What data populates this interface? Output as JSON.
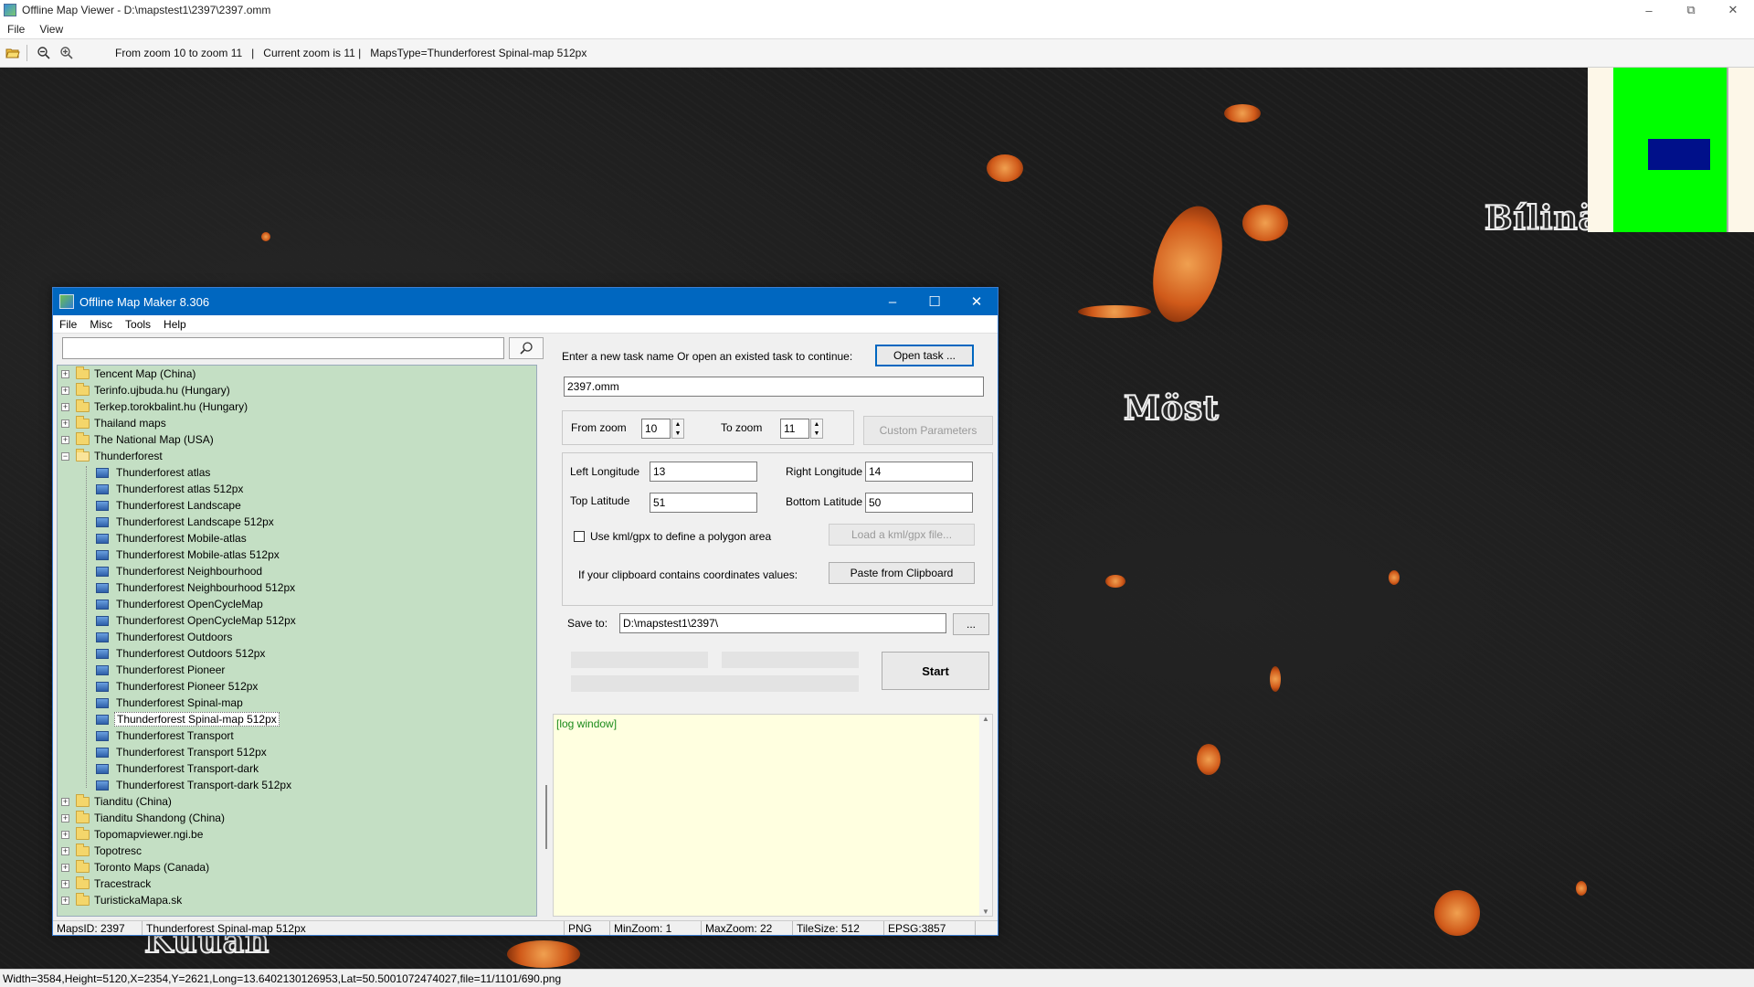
{
  "viewer": {
    "title": "Offline Map Viewer - D:\\mapstest1\\2397\\2397.omm",
    "menu": [
      "File",
      "View"
    ],
    "toolbar_text": "From zoom 10 to zoom 11   |   Current zoom is 11 |   MapsType=Thunderforest Spinal-map 512px",
    "icons": [
      "open-folder-icon",
      "zoom-out-icon",
      "zoom-in-icon"
    ],
    "status": "Width=3584,Height=5120,X=2354,Y=2621,Long=13.6402130126953,Lat=50.5001072474027,file=11/1101/690.png"
  },
  "map": {
    "places": [
      "Bílinä",
      "Möst",
      "Kuuan"
    ]
  },
  "dialog": {
    "title": "Offline Map Maker 8.306",
    "menu": [
      "File",
      "Misc",
      "Tools",
      "Help"
    ],
    "search": {
      "value": "",
      "placeholder": ""
    },
    "tree": [
      {
        "label": "Tencent Map (China)",
        "type": "folder",
        "expanded": false
      },
      {
        "label": "Terinfo.ujbuda.hu (Hungary)",
        "type": "folder",
        "expanded": false
      },
      {
        "label": "Terkep.torokbalint.hu (Hungary)",
        "type": "folder",
        "expanded": false
      },
      {
        "label": "Thailand maps",
        "type": "folder",
        "expanded": false
      },
      {
        "label": "The National Map (USA)",
        "type": "folder",
        "expanded": false
      },
      {
        "label": "Thunderforest",
        "type": "folder",
        "expanded": true
      },
      {
        "label": "Thunderforest atlas",
        "type": "map"
      },
      {
        "label": "Thunderforest atlas 512px",
        "type": "map"
      },
      {
        "label": "Thunderforest Landscape",
        "type": "map"
      },
      {
        "label": "Thunderforest Landscape 512px",
        "type": "map"
      },
      {
        "label": "Thunderforest Mobile-atlas",
        "type": "map"
      },
      {
        "label": "Thunderforest Mobile-atlas 512px",
        "type": "map"
      },
      {
        "label": "Thunderforest Neighbourhood",
        "type": "map"
      },
      {
        "label": "Thunderforest Neighbourhood 512px",
        "type": "map"
      },
      {
        "label": "Thunderforest OpenCycleMap",
        "type": "map"
      },
      {
        "label": "Thunderforest OpenCycleMap 512px",
        "type": "map"
      },
      {
        "label": "Thunderforest Outdoors",
        "type": "map"
      },
      {
        "label": "Thunderforest Outdoors 512px",
        "type": "map"
      },
      {
        "label": "Thunderforest Pioneer",
        "type": "map"
      },
      {
        "label": "Thunderforest Pioneer 512px",
        "type": "map"
      },
      {
        "label": "Thunderforest Spinal-map",
        "type": "map"
      },
      {
        "label": "Thunderforest Spinal-map 512px",
        "type": "map",
        "selected": true
      },
      {
        "label": "Thunderforest Transport",
        "type": "map"
      },
      {
        "label": "Thunderforest Transport 512px",
        "type": "map"
      },
      {
        "label": "Thunderforest Transport-dark",
        "type": "map"
      },
      {
        "label": "Thunderforest Transport-dark 512px",
        "type": "map"
      },
      {
        "label": "Tianditu (China)",
        "type": "folder",
        "expanded": false
      },
      {
        "label": "Tianditu Shandong (China)",
        "type": "folder",
        "expanded": false
      },
      {
        "label": "Topomapviewer.ngi.be",
        "type": "folder",
        "expanded": false
      },
      {
        "label": "Topotresc",
        "type": "folder",
        "expanded": false
      },
      {
        "label": "Toronto Maps (Canada)",
        "type": "folder",
        "expanded": false
      },
      {
        "label": "Tracestrack",
        "type": "folder",
        "expanded": false
      },
      {
        "label": "TuristickaMapa.sk",
        "type": "folder",
        "expanded": false
      }
    ],
    "task_prompt": "Enter a new task name Or open an existed task to continue:",
    "open_task_label": "Open task ...",
    "task_name": "2397.omm",
    "from_zoom_label": "From zoom",
    "from_zoom": "10",
    "to_zoom_label": "To zoom",
    "to_zoom": "11",
    "custom_params_label": "Custom Parameters",
    "left_lon_label": "Left Longitude",
    "left_lon": "13",
    "right_lon_label": "Right Longitude",
    "right_lon": "14",
    "top_lat_label": "Top Latitude",
    "top_lat": "51",
    "bottom_lat_label": "Bottom Latitude",
    "bottom_lat": "50",
    "kml_check_label": "Use kml/gpx to define a polygon area",
    "load_kml_label": "Load a kml/gpx file...",
    "clipboard_prompt": "If your clipboard contains coordinates values:",
    "paste_label": "Paste from Clipboard",
    "save_to_label": "Save to:",
    "save_to": "D:\\mapstest1\\2397\\",
    "browse_label": "...",
    "start_label": "Start",
    "log_text": "[log window]",
    "status": {
      "maps_id": "MapsID: 2397",
      "map_name": "Thunderforest Spinal-map 512px",
      "format": "PNG",
      "min_zoom": "MinZoom: 1",
      "max_zoom": "MaxZoom: 22",
      "tile_size": "TileSize: 512",
      "epsg": "EPSG:3857"
    }
  },
  "colors": {
    "dialog_title_bg": "#0067c0",
    "tree_bg": "#c4dfc4",
    "log_bg": "#ffffe0",
    "minimap_green": "#00ff00",
    "minimap_rect": "#00108a"
  }
}
